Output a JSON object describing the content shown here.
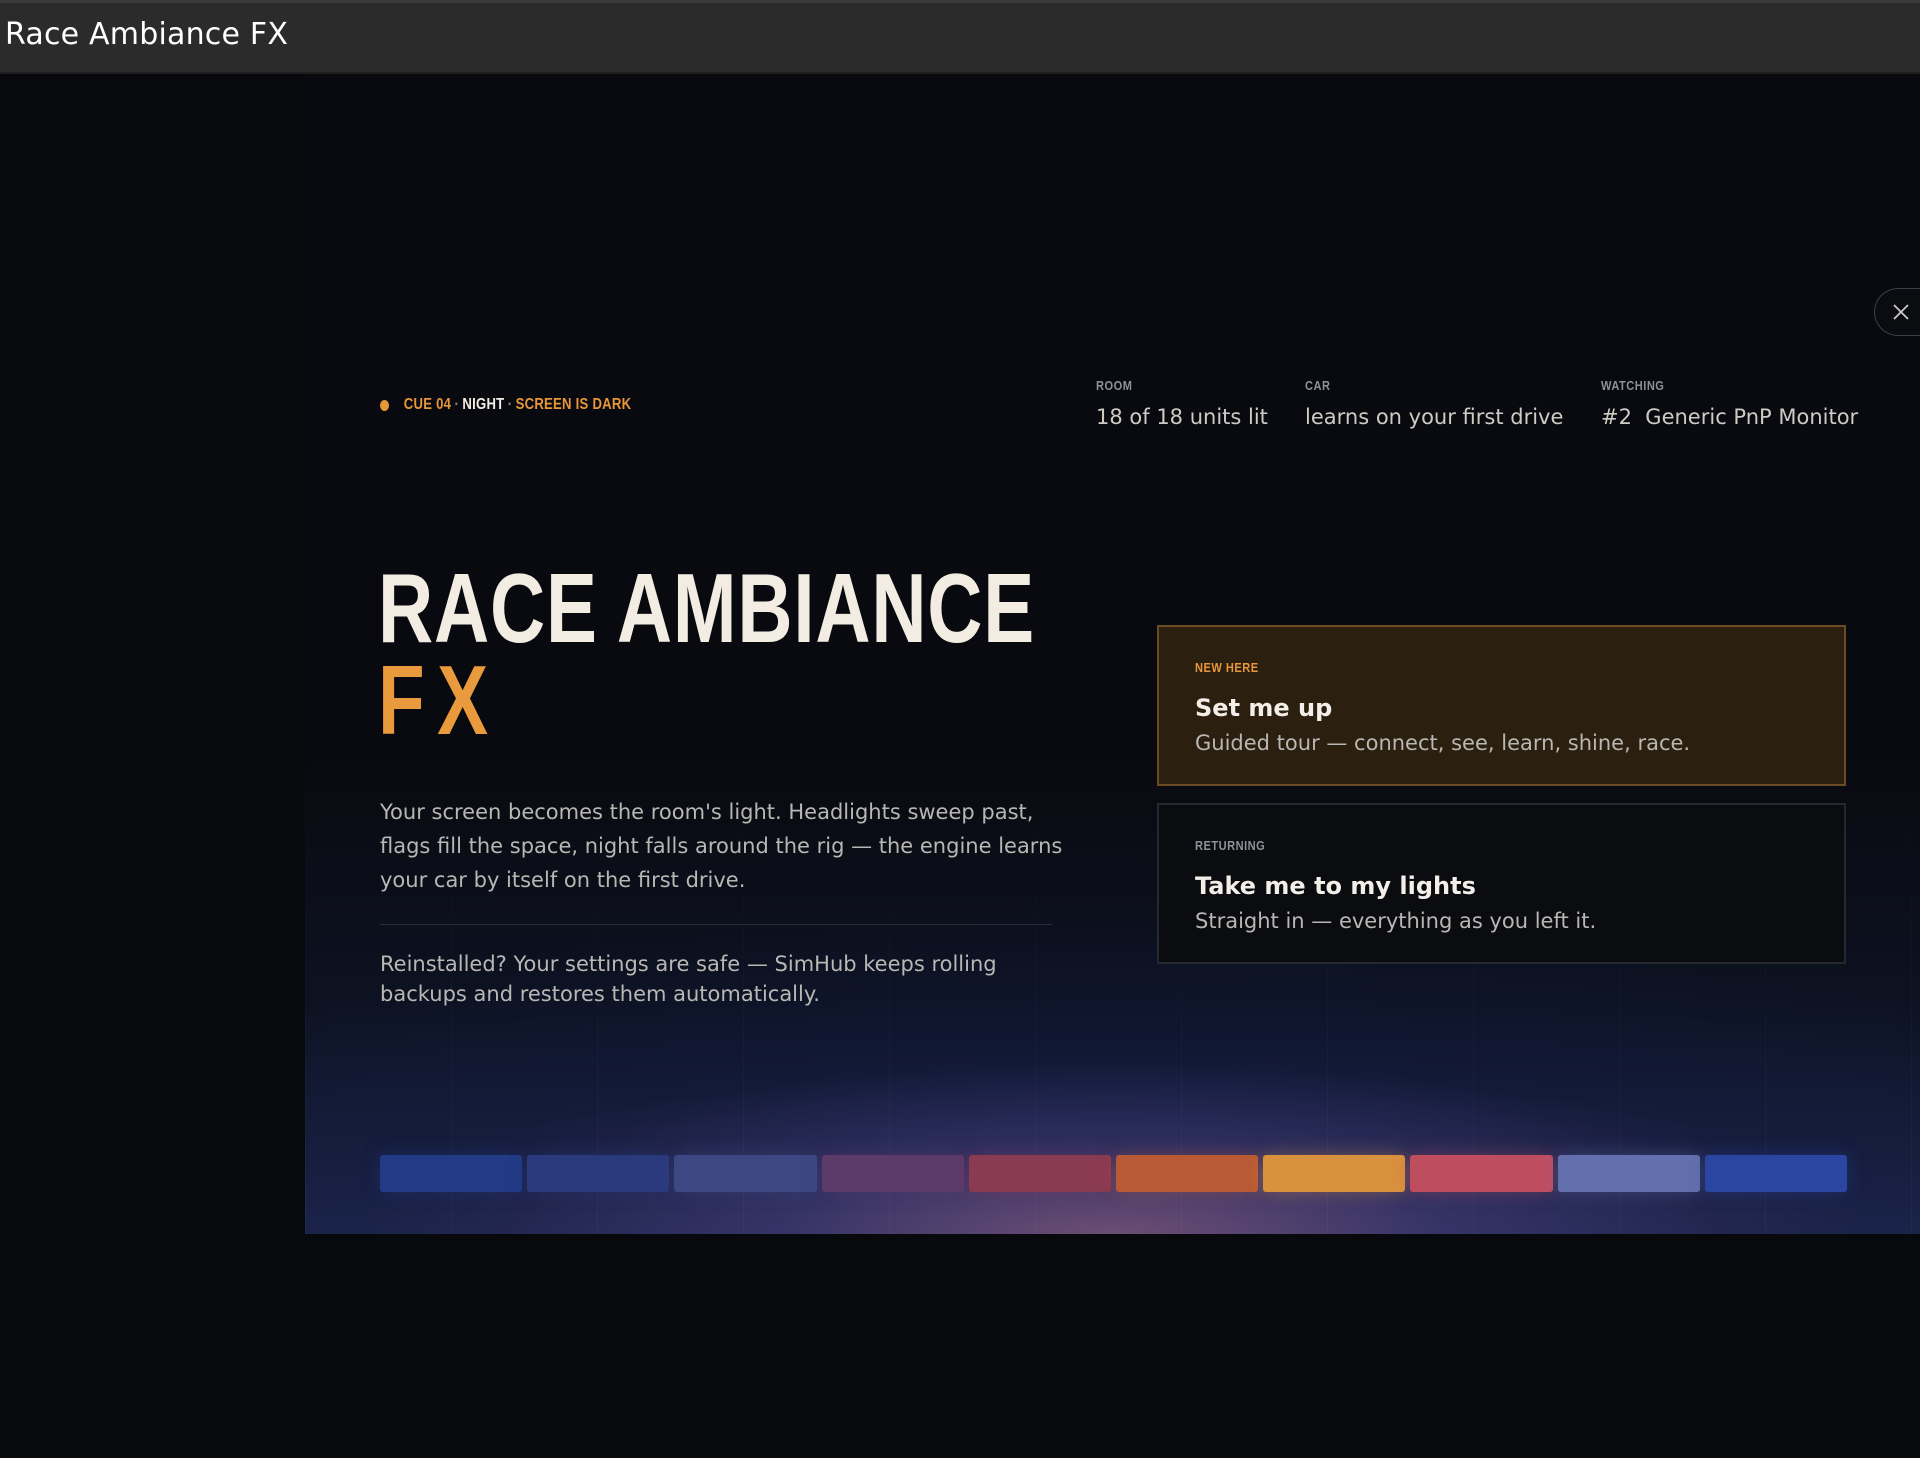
{
  "window": {
    "title": "Race Ambiance FX"
  },
  "cue": {
    "code": "CUE 04",
    "mode": "NIGHT",
    "status": "SCREEN IS DARK",
    "separator": "·"
  },
  "stats": [
    {
      "label": "ROOM",
      "value": "18 of 18 units lit"
    },
    {
      "label": "CAR",
      "value": "learns on your first drive"
    },
    {
      "label": "WATCHING",
      "value": "#2  Generic PnP Monitor"
    }
  ],
  "hero": {
    "line1": "RACE AMBIANCE",
    "line2": "FX"
  },
  "intro": "Your screen becomes the room's light. Headlights sweep past, flags fill the space, night falls around the rig — the engine learns your car by itself on the first drive.",
  "reinstall": "Reinstalled? Your settings are safe — SimHub keeps rolling backups and restores them automatically.",
  "cards": {
    "setup": {
      "eyebrow": "NEW HERE",
      "title": "Set me up",
      "subtitle": "Guided tour — connect, see, learn, shine, race."
    },
    "lights": {
      "eyebrow": "RETURNING",
      "title": "Take me to my lights",
      "subtitle": "Straight in — everything as you left it."
    }
  },
  "icons": {
    "close": "close-icon",
    "status_dot": "status-dot-icon"
  },
  "colors": {
    "accent": "#e8963a",
    "swatches": [
      "#233a86",
      "#2b3a7c",
      "#3d4882",
      "#5c3b6a",
      "#8a3a52",
      "#b95a36",
      "#d9913e",
      "#bf4d60",
      "#6470ad",
      "#2a46a0"
    ]
  }
}
